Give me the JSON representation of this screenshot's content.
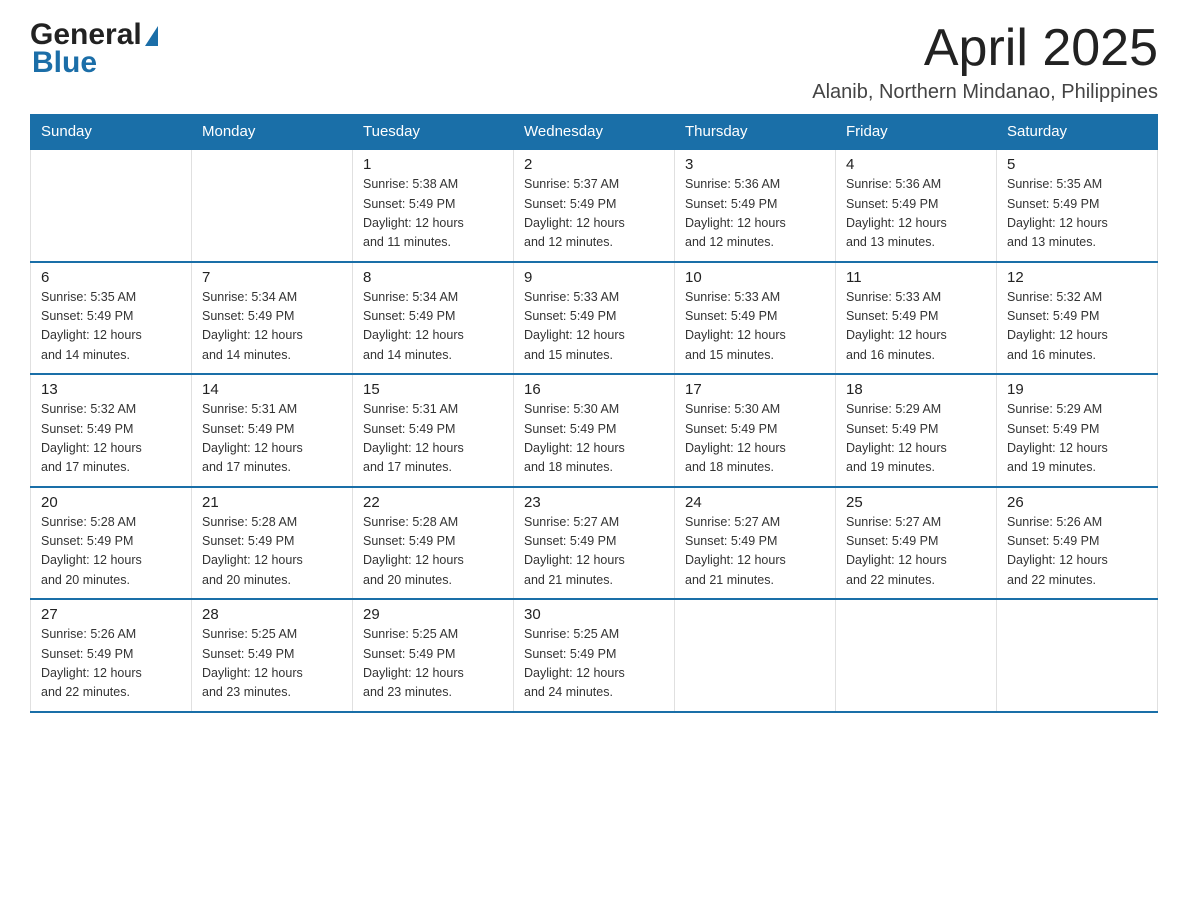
{
  "header": {
    "logo_general": "General",
    "logo_blue": "Blue",
    "month_title": "April 2025",
    "location": "Alanib, Northern Mindanao, Philippines"
  },
  "days_of_week": [
    "Sunday",
    "Monday",
    "Tuesday",
    "Wednesday",
    "Thursday",
    "Friday",
    "Saturday"
  ],
  "weeks": [
    [
      {
        "day": "",
        "info": ""
      },
      {
        "day": "",
        "info": ""
      },
      {
        "day": "1",
        "info": "Sunrise: 5:38 AM\nSunset: 5:49 PM\nDaylight: 12 hours\nand 11 minutes."
      },
      {
        "day": "2",
        "info": "Sunrise: 5:37 AM\nSunset: 5:49 PM\nDaylight: 12 hours\nand 12 minutes."
      },
      {
        "day": "3",
        "info": "Sunrise: 5:36 AM\nSunset: 5:49 PM\nDaylight: 12 hours\nand 12 minutes."
      },
      {
        "day": "4",
        "info": "Sunrise: 5:36 AM\nSunset: 5:49 PM\nDaylight: 12 hours\nand 13 minutes."
      },
      {
        "day": "5",
        "info": "Sunrise: 5:35 AM\nSunset: 5:49 PM\nDaylight: 12 hours\nand 13 minutes."
      }
    ],
    [
      {
        "day": "6",
        "info": "Sunrise: 5:35 AM\nSunset: 5:49 PM\nDaylight: 12 hours\nand 14 minutes."
      },
      {
        "day": "7",
        "info": "Sunrise: 5:34 AM\nSunset: 5:49 PM\nDaylight: 12 hours\nand 14 minutes."
      },
      {
        "day": "8",
        "info": "Sunrise: 5:34 AM\nSunset: 5:49 PM\nDaylight: 12 hours\nand 14 minutes."
      },
      {
        "day": "9",
        "info": "Sunrise: 5:33 AM\nSunset: 5:49 PM\nDaylight: 12 hours\nand 15 minutes."
      },
      {
        "day": "10",
        "info": "Sunrise: 5:33 AM\nSunset: 5:49 PM\nDaylight: 12 hours\nand 15 minutes."
      },
      {
        "day": "11",
        "info": "Sunrise: 5:33 AM\nSunset: 5:49 PM\nDaylight: 12 hours\nand 16 minutes."
      },
      {
        "day": "12",
        "info": "Sunrise: 5:32 AM\nSunset: 5:49 PM\nDaylight: 12 hours\nand 16 minutes."
      }
    ],
    [
      {
        "day": "13",
        "info": "Sunrise: 5:32 AM\nSunset: 5:49 PM\nDaylight: 12 hours\nand 17 minutes."
      },
      {
        "day": "14",
        "info": "Sunrise: 5:31 AM\nSunset: 5:49 PM\nDaylight: 12 hours\nand 17 minutes."
      },
      {
        "day": "15",
        "info": "Sunrise: 5:31 AM\nSunset: 5:49 PM\nDaylight: 12 hours\nand 17 minutes."
      },
      {
        "day": "16",
        "info": "Sunrise: 5:30 AM\nSunset: 5:49 PM\nDaylight: 12 hours\nand 18 minutes."
      },
      {
        "day": "17",
        "info": "Sunrise: 5:30 AM\nSunset: 5:49 PM\nDaylight: 12 hours\nand 18 minutes."
      },
      {
        "day": "18",
        "info": "Sunrise: 5:29 AM\nSunset: 5:49 PM\nDaylight: 12 hours\nand 19 minutes."
      },
      {
        "day": "19",
        "info": "Sunrise: 5:29 AM\nSunset: 5:49 PM\nDaylight: 12 hours\nand 19 minutes."
      }
    ],
    [
      {
        "day": "20",
        "info": "Sunrise: 5:28 AM\nSunset: 5:49 PM\nDaylight: 12 hours\nand 20 minutes."
      },
      {
        "day": "21",
        "info": "Sunrise: 5:28 AM\nSunset: 5:49 PM\nDaylight: 12 hours\nand 20 minutes."
      },
      {
        "day": "22",
        "info": "Sunrise: 5:28 AM\nSunset: 5:49 PM\nDaylight: 12 hours\nand 20 minutes."
      },
      {
        "day": "23",
        "info": "Sunrise: 5:27 AM\nSunset: 5:49 PM\nDaylight: 12 hours\nand 21 minutes."
      },
      {
        "day": "24",
        "info": "Sunrise: 5:27 AM\nSunset: 5:49 PM\nDaylight: 12 hours\nand 21 minutes."
      },
      {
        "day": "25",
        "info": "Sunrise: 5:27 AM\nSunset: 5:49 PM\nDaylight: 12 hours\nand 22 minutes."
      },
      {
        "day": "26",
        "info": "Sunrise: 5:26 AM\nSunset: 5:49 PM\nDaylight: 12 hours\nand 22 minutes."
      }
    ],
    [
      {
        "day": "27",
        "info": "Sunrise: 5:26 AM\nSunset: 5:49 PM\nDaylight: 12 hours\nand 22 minutes."
      },
      {
        "day": "28",
        "info": "Sunrise: 5:25 AM\nSunset: 5:49 PM\nDaylight: 12 hours\nand 23 minutes."
      },
      {
        "day": "29",
        "info": "Sunrise: 5:25 AM\nSunset: 5:49 PM\nDaylight: 12 hours\nand 23 minutes."
      },
      {
        "day": "30",
        "info": "Sunrise: 5:25 AM\nSunset: 5:49 PM\nDaylight: 12 hours\nand 24 minutes."
      },
      {
        "day": "",
        "info": ""
      },
      {
        "day": "",
        "info": ""
      },
      {
        "day": "",
        "info": ""
      }
    ]
  ],
  "colors": {
    "header_bg": "#1a6fa8",
    "header_text": "#ffffff",
    "border": "#1a6fa8",
    "accent": "#1b6ea8"
  }
}
